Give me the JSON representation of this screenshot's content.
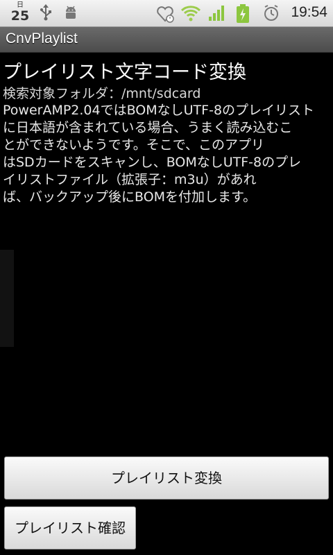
{
  "status_bar": {
    "date_top": "日",
    "date_num": "25",
    "time": "19:54",
    "icons": [
      "usb-icon",
      "android-debug-icon",
      "heart-alarm-icon",
      "wifi-icon",
      "signal-icon",
      "battery-charging-icon",
      "alarm-clock-icon"
    ]
  },
  "app": {
    "title": "CnvPlaylist"
  },
  "main": {
    "heading": "プレイリスト文字コード変換",
    "folder_label": "検索対象フォルダ：/mnt/sdcard",
    "description_lines": [
      "PowerAMP2.04ではBOMなしUTF-8のプレイリスト",
      "に日本語が含まれている場合、うまく読み込むこ",
      "とができないようです。そこで、このアプリ",
      "はSDカードをスキャンし、BOMなしUTF-8のプレ",
      "イリストファイル（拡張子：m3u）があれ",
      "ば、バックアップ後にBOMを付加します。"
    ]
  },
  "buttons": {
    "convert_label": "プレイリスト変換",
    "check_label": "プレイリスト確認"
  },
  "colors": {
    "background": "#000000",
    "titlebar": "#5a5a5a",
    "signal_green": "#8cc63f"
  }
}
